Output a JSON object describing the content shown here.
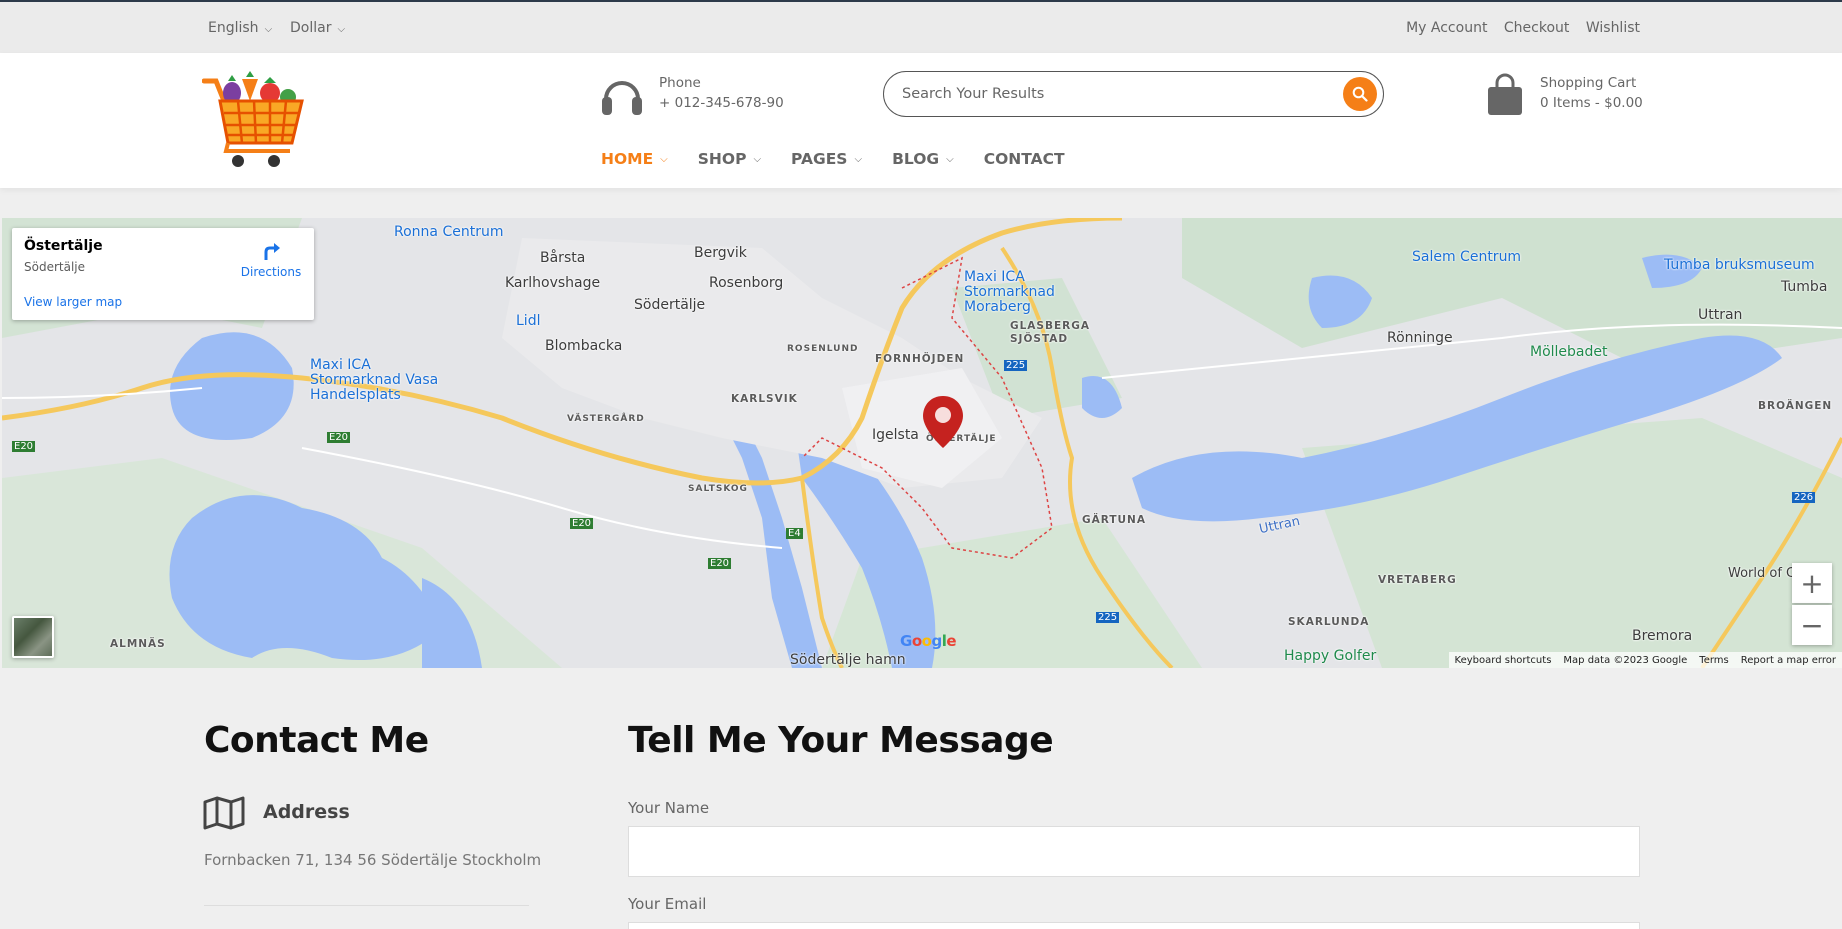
{
  "topbar": {
    "language": "English",
    "currency": "Dollar",
    "links": [
      "My Account",
      "Checkout",
      "Wishlist"
    ]
  },
  "header": {
    "phone_label": "Phone",
    "phone_number": "+ 012-345-678-90",
    "search_placeholder": "Search Your Results",
    "cart_title": "Shopping Cart",
    "cart_info": "0 Items - $0.00"
  },
  "nav": {
    "items": [
      {
        "label": "HOME",
        "active": true,
        "dropdown": true
      },
      {
        "label": "SHOP",
        "active": false,
        "dropdown": true
      },
      {
        "label": "PAGES",
        "active": false,
        "dropdown": true
      },
      {
        "label": "BLOG",
        "active": false,
        "dropdown": true
      },
      {
        "label": "CONTACT",
        "active": false,
        "dropdown": false
      }
    ]
  },
  "map": {
    "place_name": "Östertälje",
    "place_sub": "Södertälje",
    "directions_label": "Directions",
    "larger_map_label": "View larger map",
    "attribution": [
      "Keyboard shortcuts",
      "Map data ©2023 Google",
      "Terms",
      "Report a map error"
    ],
    "labels": [
      {
        "text": "Ronna Centrum",
        "kind": "poi"
      },
      {
        "text": "Bårsta",
        "kind": "place"
      },
      {
        "text": "Bergvik",
        "kind": "place"
      },
      {
        "text": "Karlhovshage",
        "kind": "place"
      },
      {
        "text": "Rosenborg",
        "kind": "place"
      },
      {
        "text": "Södertälje",
        "kind": "place"
      },
      {
        "text": "Lidl",
        "kind": "poi"
      },
      {
        "text": "Blombacka",
        "kind": "place"
      },
      {
        "text": "Maxi ICA Stormarknad Vasa Handelsplats",
        "kind": "poi"
      },
      {
        "text": "Maxi ICA Stormarknad Moraberg",
        "kind": "poi"
      },
      {
        "text": "GLASBERGA SJÖSTAD",
        "kind": "district"
      },
      {
        "text": "FORNHÖJDEN",
        "kind": "district"
      },
      {
        "text": "ROSENLUND",
        "kind": "district"
      },
      {
        "text": "KARLSVIK",
        "kind": "district"
      },
      {
        "text": "VÄSTERGÅRD",
        "kind": "district"
      },
      {
        "text": "Igelsta",
        "kind": "place"
      },
      {
        "text": "ÖSTERTÄLJE",
        "kind": "district"
      },
      {
        "text": "SALTSKOG",
        "kind": "district"
      },
      {
        "text": "GÄRTUNA",
        "kind": "district"
      },
      {
        "text": "Salem Centrum",
        "kind": "poi"
      },
      {
        "text": "Tumba bruksmuseum",
        "kind": "poi"
      },
      {
        "text": "Tumba",
        "kind": "place"
      },
      {
        "text": "Uttran",
        "kind": "place"
      },
      {
        "text": "Rönninge",
        "kind": "place"
      },
      {
        "text": "Möllebadet",
        "kind": "green"
      },
      {
        "text": "BROÄNGEN",
        "kind": "district"
      },
      {
        "text": "Uttran",
        "kind": "water"
      },
      {
        "text": "VRETABERG",
        "kind": "district"
      },
      {
        "text": "SKARLUNDA",
        "kind": "district"
      },
      {
        "text": "Happy Golfer",
        "kind": "green"
      },
      {
        "text": "Bremora",
        "kind": "place"
      },
      {
        "text": "ALMNÄS",
        "kind": "district"
      },
      {
        "text": "Södertälje hamn",
        "kind": "place"
      },
      {
        "text": "World of Cu...",
        "kind": "place"
      }
    ],
    "road_labels": [
      "E20",
      "E20",
      "E20",
      "E20",
      "E4",
      "225",
      "225",
      "226"
    ]
  },
  "contact": {
    "title": "Contact Me",
    "address_label": "Address",
    "address": "Fornbacken 71, 134 56 Södertälje Stockholm"
  },
  "form": {
    "title": "Tell Me Your Message",
    "name_label": "Your Name",
    "email_label": "Your Email"
  },
  "colors": {
    "accent": "#f57f17",
    "water": "#9cbcf5",
    "park": "#c8dfcc",
    "road": "#f5c85c"
  }
}
